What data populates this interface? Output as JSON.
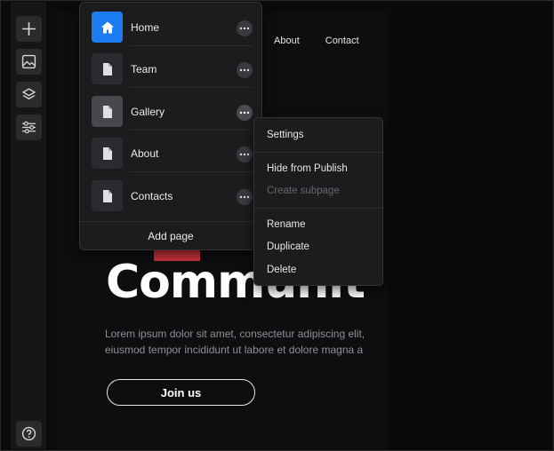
{
  "toolbar": {
    "buttons": [
      {
        "icon": "plus-icon"
      },
      {
        "icon": "image-icon"
      },
      {
        "icon": "layers-icon"
      },
      {
        "icon": "sliders-icon"
      }
    ],
    "help_icon": "help-icon"
  },
  "site": {
    "nav": [
      "About",
      "Contact"
    ],
    "hero_title": "Communit",
    "hero_text_line1": "Lorem ipsum dolor sit amet, consectetur adipiscing elit,",
    "hero_text_line2": "eiusmod tempor incididunt ut labore et dolore magna a",
    "cta_label": "Join us",
    "accent_color": "#c8323a"
  },
  "pages_panel": {
    "pages": [
      {
        "label": "Home",
        "state": "active"
      },
      {
        "label": "Team",
        "state": "normal"
      },
      {
        "label": "Gallery",
        "state": "selected"
      },
      {
        "label": "About",
        "state": "normal"
      },
      {
        "label": "Contacts",
        "state": "normal"
      }
    ],
    "add_page_label": "Add page",
    "active_color": "#1d7cf2"
  },
  "context_menu": {
    "items": [
      {
        "label": "Settings",
        "enabled": true
      },
      {
        "label": "Hide from Publish",
        "enabled": true
      },
      {
        "label": "Create subpage",
        "enabled": false
      },
      {
        "label": "Rename",
        "enabled": true
      },
      {
        "label": "Duplicate",
        "enabled": true
      },
      {
        "label": "Delete",
        "enabled": true
      }
    ]
  }
}
